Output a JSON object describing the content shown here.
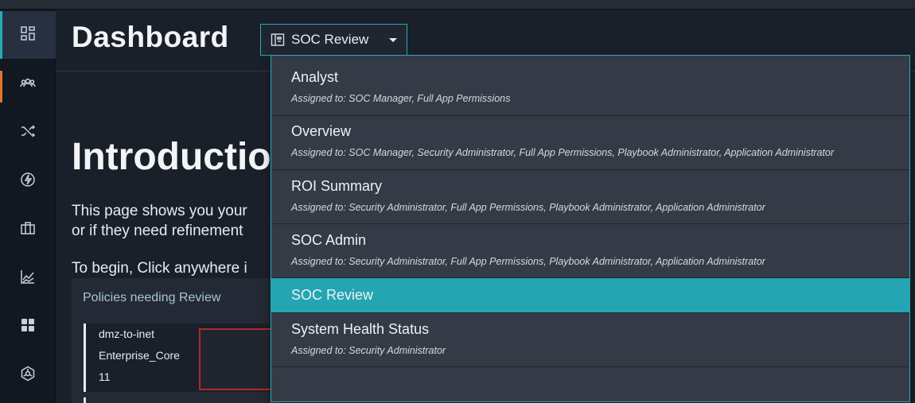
{
  "header": {
    "title": "Dashboard",
    "selected_dashboard": "SOC Review",
    "selector_icon": "dashboard-layout-icon"
  },
  "sidebar": {
    "items": [
      {
        "name": "dashboard",
        "icon": "grid-icon",
        "active": true
      },
      {
        "name": "users",
        "icon": "users-icon",
        "active": false
      },
      {
        "name": "shuffle",
        "icon": "shuffle-icon",
        "active": false
      },
      {
        "name": "bolt",
        "icon": "bolt-icon",
        "active": false
      },
      {
        "name": "briefcase",
        "icon": "briefcase-icon",
        "active": false
      },
      {
        "name": "reports",
        "icon": "line-chart-icon",
        "active": false
      },
      {
        "name": "apps",
        "icon": "apps-icon",
        "active": false
      },
      {
        "name": "settings",
        "icon": "hexagon-icon",
        "active": false
      }
    ],
    "accent_color": "#e0752b"
  },
  "main": {
    "intro_title": "Introductio",
    "intro_line1": "This page shows you your",
    "intro_line2": "or if they need refinement",
    "intro_line3": "To begin, Click anywhere i",
    "panel": {
      "title": "Policies needing Review",
      "card": {
        "line1": "dmz-to-inet",
        "line2": "Enterprise_Core",
        "line3": "11"
      }
    }
  },
  "dropdown": {
    "accent_color": "#2aa7b5",
    "items": [
      {
        "name": "Analyst",
        "assigned": "Assigned to: SOC Manager, Full App Permissions",
        "selected": false
      },
      {
        "name": "Overview",
        "assigned": "Assigned to: SOC Manager, Security Administrator, Full App Permissions, Playbook Administrator, Application Administrator",
        "selected": false
      },
      {
        "name": "ROI Summary",
        "assigned": "Assigned to: Security Administrator, Full App Permissions, Playbook Administrator, Application Administrator",
        "selected": false
      },
      {
        "name": "SOC Admin",
        "assigned": "Assigned to: Security Administrator, Full App Permissions, Playbook Administrator, Application Administrator",
        "selected": false
      },
      {
        "name": "SOC Review",
        "assigned": "",
        "selected": true
      },
      {
        "name": "System Health Status",
        "assigned": "Assigned to: Security Administrator",
        "selected": false
      }
    ]
  }
}
